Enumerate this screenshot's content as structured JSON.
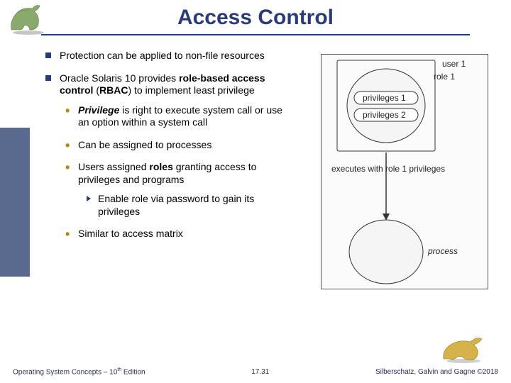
{
  "title": "Access Control",
  "bullets": {
    "b1": "Protection can be applied to non-file resources",
    "b2a": "Oracle Solaris 10 provides ",
    "b2b": "role-based access control",
    "b2c": " (",
    "b2d": "RBAC",
    "b2e": ") to implement least privilege",
    "s1a": "Privilege",
    "s1b": " is right to execute system call or use an option within a system call",
    "s2": "Can be assigned to processes",
    "s3a": "Users assigned ",
    "s3b": "roles",
    "s3c": " granting access to privileges and programs",
    "ss1": "Enable role via password to gain its privileges",
    "s4": "Similar to access matrix"
  },
  "diagram": {
    "user1": "user 1",
    "role1": "role 1",
    "priv1": "privileges 1",
    "priv2": "privileges 2",
    "exec": "executes with role 1 privileges",
    "process": "process"
  },
  "footer": {
    "left_a": "Operating System Concepts – 10",
    "left_sup": "th",
    "left_b": " Edition",
    "center": "17.31",
    "right": "Silberschatz, Galvin and Gagne ©2018"
  }
}
